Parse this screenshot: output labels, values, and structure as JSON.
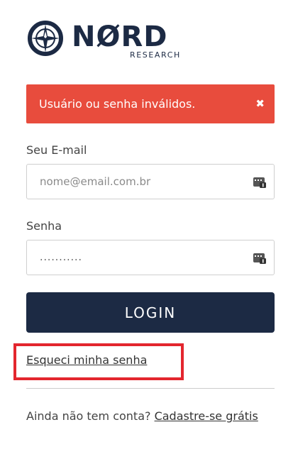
{
  "brand": {
    "logo_word": "NØRD",
    "logo_sub": "RESEARCH",
    "color": "#1c2a44",
    "icon": "compass-icon"
  },
  "alert": {
    "message": "Usuário ou senha inválidos.",
    "close_symbol": "✖",
    "color": "#e84c3d"
  },
  "form": {
    "email_label": "Seu E-mail",
    "email_placeholder": "nome@email.com.br",
    "email_value": "",
    "password_label": "Senha",
    "password_value": "...........",
    "field_icon": "password-manager-key-icon",
    "login_label": "LOGIN",
    "login_color": "#1c2a44"
  },
  "links": {
    "forgot_password": "Esqueci minha senha",
    "signup_prompt": "Ainda não tem conta?",
    "signup_link": "Cadastre-se grátis"
  },
  "highlight": {
    "target": "forgot_password",
    "color": "#e3262e"
  }
}
